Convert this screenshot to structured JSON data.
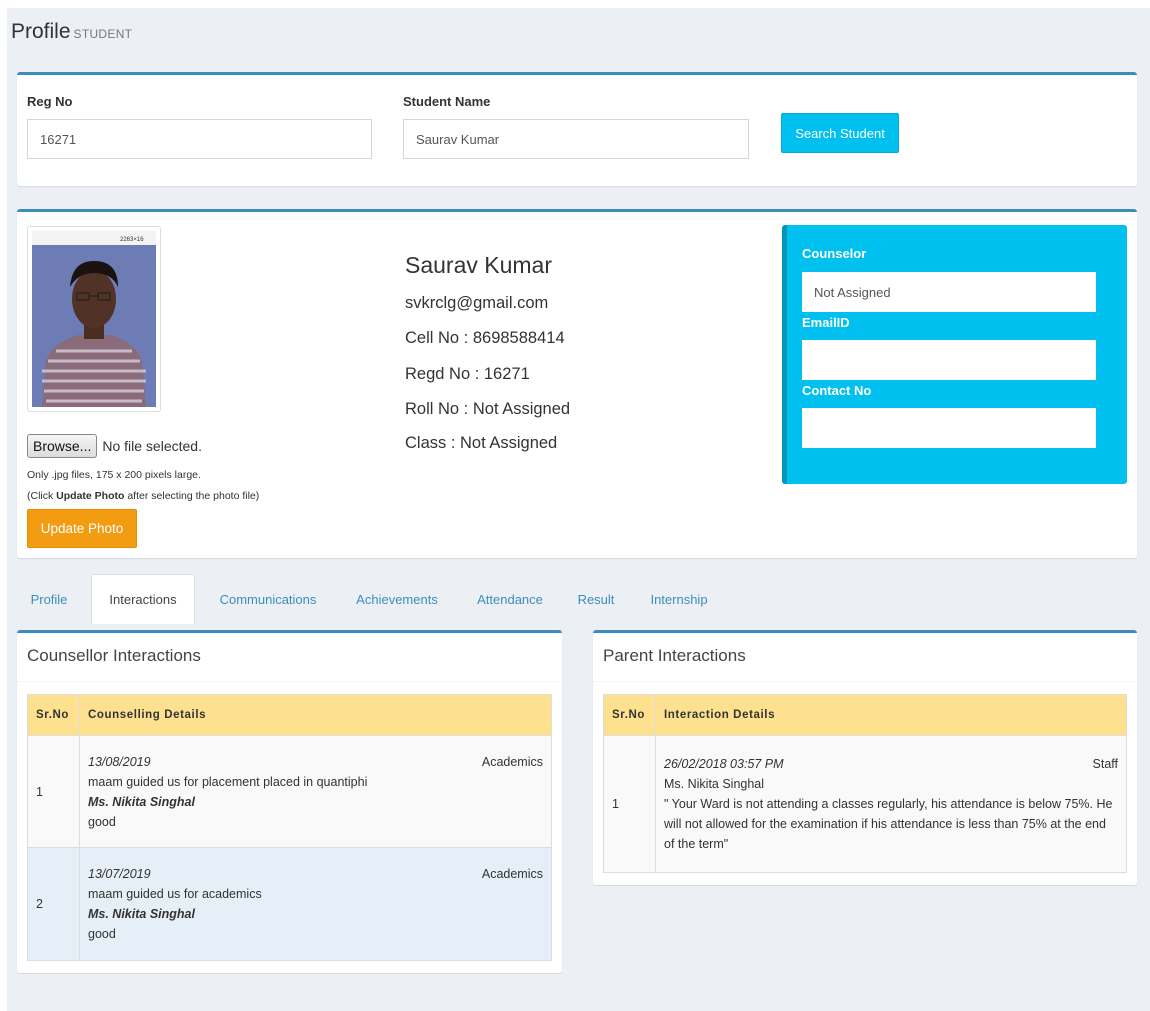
{
  "header": {
    "title": "Profile",
    "subtitle": "STUDENT"
  },
  "search": {
    "reg_label": "Reg No",
    "reg_value": "16271",
    "name_label": "Student Name",
    "name_value": "Saurav Kumar",
    "button_label": "Search Student"
  },
  "profile": {
    "upload": {
      "browse_label": "Browse...",
      "file_status": "No file selected.",
      "note1": "Only .jpg files, 175 x 200 pixels large.",
      "note2_prefix": "(Click ",
      "note2_bold": "Update Photo",
      "note2_suffix": " after selecting the photo file)",
      "update_button": "Update Photo"
    },
    "name": "Saurav Kumar",
    "email": "svkrclg@gmail.com",
    "cell": "Cell No : 8698588414",
    "regd": "Regd No : 16271",
    "roll": "Roll No : Not Assigned",
    "class": "Class : Not Assigned",
    "photo_stamp": "2263×16"
  },
  "counselor": {
    "counselor_label": "Counselor",
    "counselor_value": "Not Assigned",
    "email_label": "EmailID",
    "email_value": "",
    "contact_label": "Contact No",
    "contact_value": ""
  },
  "tabs": [
    "Profile",
    "Interactions",
    "Communications",
    "Achievements",
    "Attendance",
    "Result",
    "Internship"
  ],
  "active_tab": "Interactions",
  "counsellor_panel": {
    "title": "Counsellor Interactions",
    "col_sr": "Sr.No",
    "col_details": "Counselling Details",
    "rows": [
      {
        "sr": "1",
        "date": "13/08/2019",
        "category": "Academics",
        "text": "maam guided us for placement placed in quantiphi",
        "counsellor": "Ms. Nikita Singhal",
        "remark": "good"
      },
      {
        "sr": "2",
        "date": "13/07/2019",
        "category": "Academics",
        "text": "maam guided us for academics",
        "counsellor": "Ms. Nikita Singhal",
        "remark": "good"
      }
    ]
  },
  "parent_panel": {
    "title": "Parent Interactions",
    "col_sr": "Sr.No",
    "col_details": "Interaction Details",
    "rows": [
      {
        "sr": "1",
        "date": "26/02/2018 03:57 PM",
        "category": "Staff",
        "by": "Ms. Nikita Singhal",
        "text": "\" Your Ward is not attending a classes regularly, his attendance is below 75%. He will not allowed for the examination if his attendance is less than 75% at the end of the term\""
      }
    ]
  },
  "colors": {
    "primary": "#3c8dbc",
    "info": "#00c0ef",
    "warning": "#f39c12",
    "table_header": "#fde18f"
  }
}
